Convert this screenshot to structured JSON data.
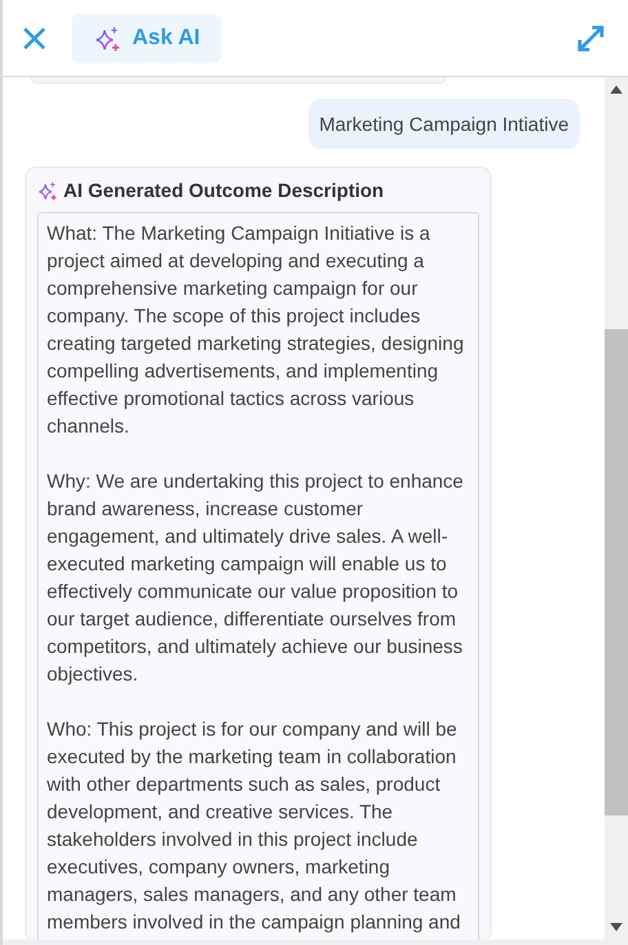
{
  "header": {
    "ask_ai_label": "Ask AI"
  },
  "messages": [
    {
      "kind": "user",
      "text": "Marketing Campaign Intiative"
    },
    {
      "kind": "ai",
      "title": "AI Generated Outcome Description",
      "paragraphs": [
        "What: The Marketing Campaign Initiative is a project aimed at developing and executing a comprehensive marketing campaign for our company. The scope of this project includes creating targeted marketing strategies, designing compelling advertisements, and implementing effective promotional tactics across various channels.",
        "Why: We are undertaking this project to enhance brand awareness, increase customer engagement, and ultimately drive sales. A well-executed marketing campaign will enable us to effectively communicate our value proposition to our target audience, differentiate ourselves from competitors, and ultimately achieve our business objectives.",
        "Who: This project is for our company and will be executed by the marketing team in collaboration with other departments such as sales, product development, and creative services. The stakeholders involved in this project include executives, company owners, marketing managers, sales managers, and any other team members involved in the campaign planning and"
      ]
    }
  ]
}
